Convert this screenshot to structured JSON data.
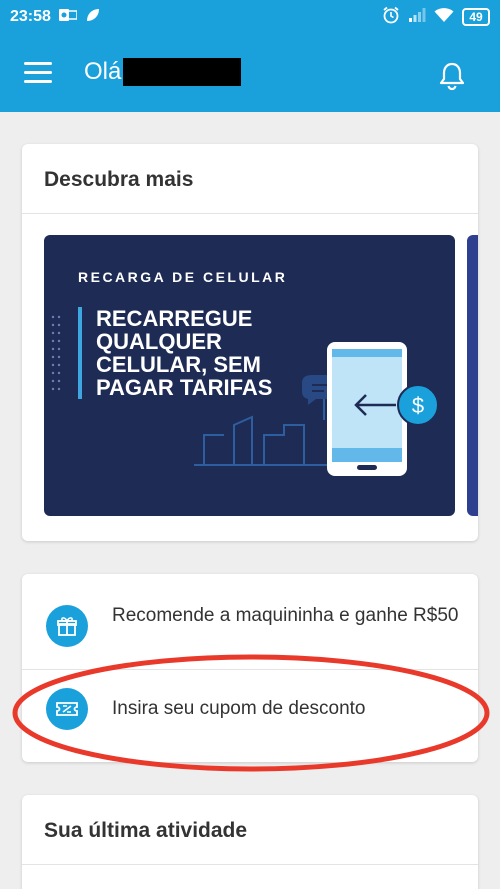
{
  "status_bar": {
    "time": "23:58",
    "battery": "49"
  },
  "header": {
    "greeting": "Olá"
  },
  "discover": {
    "title": "Descubra mais",
    "banner": {
      "tag": "RECARGA DE CELULAR",
      "headline": "RECARREGUE QUALQUER CELULAR, SEM PAGAR TARIFAS"
    }
  },
  "actions": {
    "items": [
      {
        "label": "Recomende a maquininha e ganhe R$50",
        "icon": "gift-icon"
      },
      {
        "label": "Insira seu cupom de desconto",
        "icon": "ticket-icon"
      }
    ]
  },
  "activity": {
    "title": "Sua última atividade"
  },
  "colors": {
    "primary": "#1aa0db",
    "banner_bg": "#1d2b55",
    "annotation": "#e8392b"
  }
}
